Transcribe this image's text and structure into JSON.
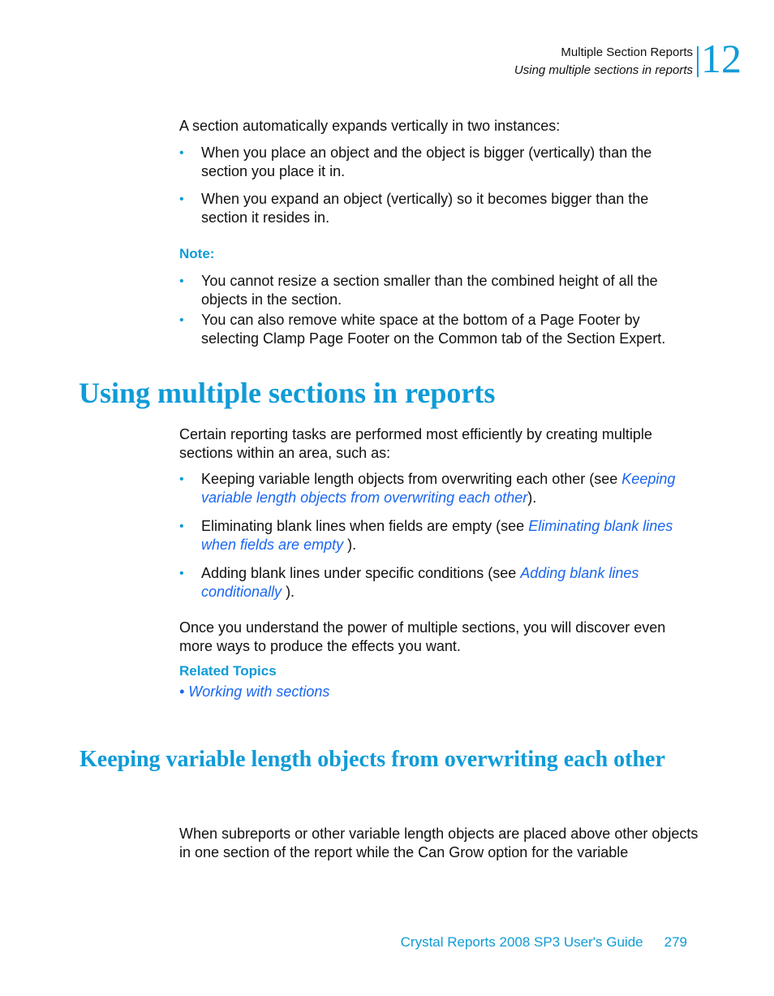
{
  "header": {
    "chapter_title": "Multiple Section Reports",
    "section_title": "Using multiple sections in reports",
    "chapter_number": "12"
  },
  "intro": {
    "text": "A section automatically expands vertically in two instances:",
    "bullets": [
      "When you place an object and the object is bigger (vertically) than the section you place it in.",
      "When you expand an object (vertically) so it becomes bigger than the section it resides in."
    ]
  },
  "note": {
    "label": "Note:",
    "bullets": [
      "You cannot resize a section smaller than the combined height of all the objects in the section.",
      "You can also remove white space at the bottom of a Page Footer by selecting Clamp Page Footer on the Common tab of the Section Expert."
    ]
  },
  "section1": {
    "heading": "Using multiple sections in reports",
    "intro": "Certain reporting tasks are performed most efficiently by creating multiple sections within an area, such as:",
    "bullets": [
      {
        "text": "Keeping variable length objects from overwriting each other (see ",
        "link": "Keeping variable length objects from overwriting each other",
        "suffix": ")."
      },
      {
        "text": "Eliminating blank lines when fields are empty (see ",
        "link": "Eliminating blank lines when fields are empty",
        "suffix": " )."
      },
      {
        "text": "Adding blank lines under specific conditions (see ",
        "link": "Adding blank lines conditionally",
        "suffix": " )."
      }
    ],
    "closing": "Once you understand the power of multiple sections, you will discover even more ways to produce the effects you want.",
    "related_label": "Related Topics",
    "related_links": [
      "• Working with sections"
    ]
  },
  "section2": {
    "heading": "Keeping variable length objects from overwriting each other",
    "text": "When subreports or other variable length objects are placed above other objects in one section of the report while the Can Grow option for the variable"
  },
  "footer": {
    "book_title": "Crystal Reports 2008 SP3 User's Guide",
    "page_number": "279"
  }
}
